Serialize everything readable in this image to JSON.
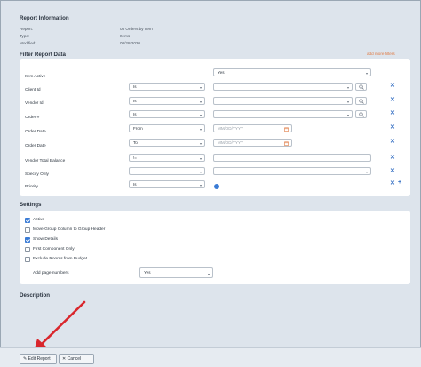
{
  "report_info": {
    "title": "Report Information",
    "rows": [
      {
        "label": "Report:",
        "value": "08 Orders by Item"
      },
      {
        "label": "Type:",
        "value": "Items"
      },
      {
        "label": "Modified:",
        "value": "08/28/2020"
      }
    ]
  },
  "filter": {
    "title": "Filter Report Data",
    "add_more_label": "add more filters",
    "rows": [
      {
        "label": "Item Active",
        "value": "Yes"
      },
      {
        "label": "Client Id",
        "operator": "Is"
      },
      {
        "label": "Vendor Id",
        "operator": "Is"
      },
      {
        "label": "Order #",
        "operator": "Is"
      },
      {
        "label": "Order Date",
        "operator": "From",
        "placeholder": "MM/DD/YYYY"
      },
      {
        "label": "Order Date",
        "operator": "To",
        "placeholder": "MM/DD/YYYY"
      },
      {
        "label": "Vendor Total Balance",
        "operator": "!="
      },
      {
        "label": "Specify Only"
      },
      {
        "label": "Priority",
        "operator": "Is"
      }
    ],
    "remove_symbol": "✕",
    "add_symbol": "+"
  },
  "settings": {
    "title": "Settings",
    "options": [
      {
        "label": "Active",
        "checked": true
      },
      {
        "label": "Move Group Column to Group Header",
        "checked": false
      },
      {
        "label": "Show Details",
        "checked": true
      },
      {
        "label": "First Component Only",
        "checked": false
      },
      {
        "label": "Exclude Rooms from Budget",
        "checked": false
      }
    ],
    "page_numbers_label": "Add page numbers",
    "page_numbers_value": "Yes"
  },
  "description": {
    "title": "Description"
  },
  "footer": {
    "edit_label": "Edit Report",
    "cancel_label": "Cancel"
  },
  "colors": {
    "accent": "#3a7bd5",
    "link": "#e07a43",
    "arrow": "#d9262c"
  }
}
